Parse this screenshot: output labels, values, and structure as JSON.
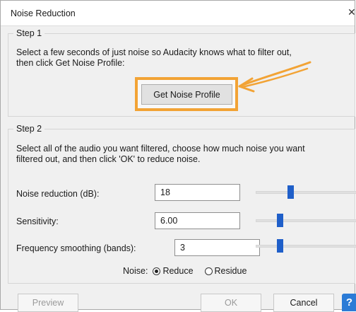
{
  "window": {
    "title": "Noise Reduction"
  },
  "step1": {
    "label": "Step 1",
    "line1": "Select a few seconds of just noise so Audacity knows what to filter out,",
    "line2": "then click Get Noise Profile:",
    "get_noise_profile_label": "Get Noise Profile"
  },
  "step2": {
    "label": "Step 2",
    "line1": "Select all of the audio you want filtered, choose how much noise you want",
    "line2": "filtered out, and then click 'OK' to reduce noise."
  },
  "fields": [
    {
      "label": "Noise reduction (dB):",
      "value": "18"
    },
    {
      "label": "Sensitivity:",
      "value": "6.00"
    },
    {
      "label": "Frequency smoothing (bands):",
      "value": "3"
    }
  ],
  "noise": {
    "label": "Noise:",
    "options": [
      "Reduce",
      "Residue"
    ],
    "selected": "Reduce"
  },
  "buttons": {
    "preview": "Preview",
    "ok": "OK",
    "cancel": "Cancel",
    "help": "?"
  },
  "colors": {
    "highlight": "#f2a335",
    "slider_thumb": "#1f5fc9",
    "help": "#2b7bd6"
  }
}
